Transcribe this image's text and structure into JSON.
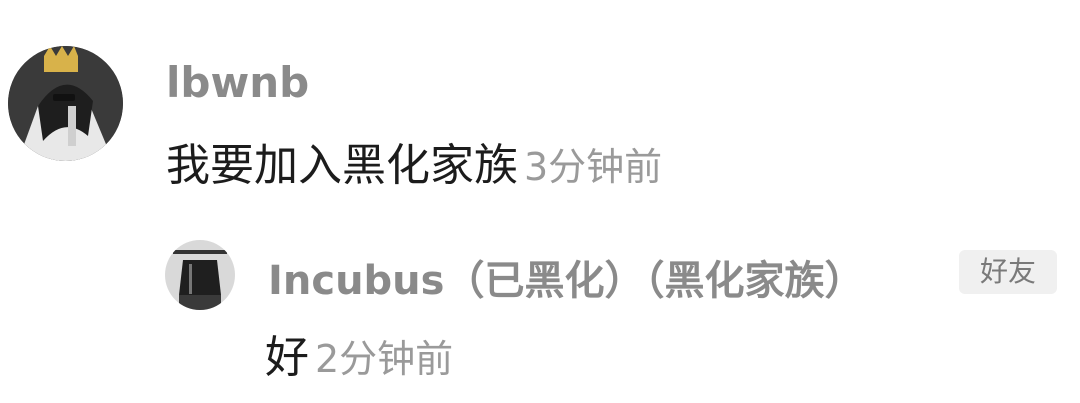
{
  "comments": [
    {
      "username": "lbwnb",
      "content": "我要加入黑化家族",
      "time": "3分钟前"
    },
    {
      "username": "Incubus（已黑化）（黑化家族）",
      "badge": "好友",
      "content": "好",
      "time": "2分钟前"
    }
  ],
  "colors": {
    "username": "#8a8a8a",
    "content": "#1c1c1c",
    "timestamp": "#9a9a9a",
    "badge_bg": "#f0f0f0"
  }
}
